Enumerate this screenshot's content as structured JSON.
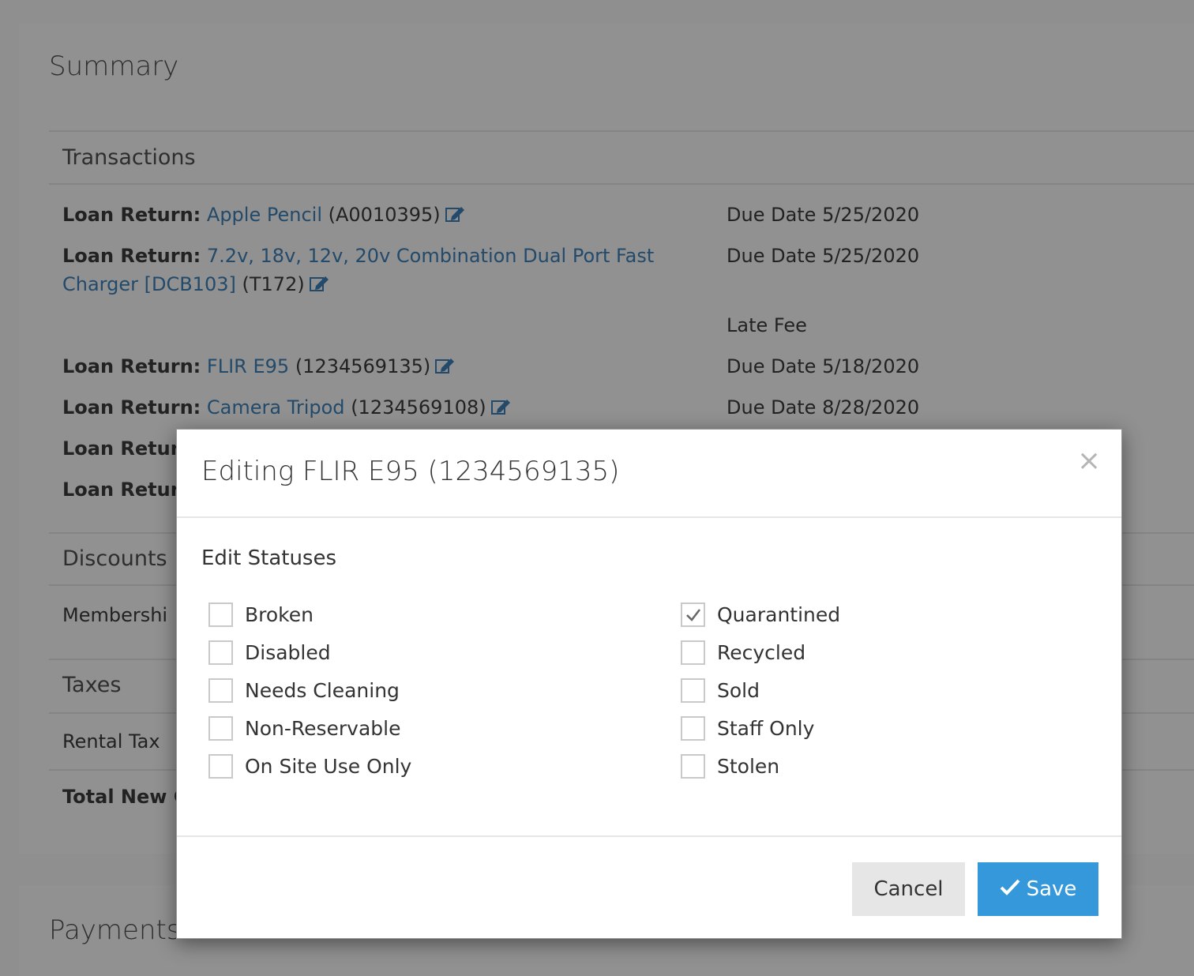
{
  "summary": {
    "title": "Summary",
    "transactions_title": "Transactions",
    "loan_label": "Loan Return:",
    "rows": [
      {
        "item": "Apple Pencil",
        "code": "(A0010395)",
        "due": "Due Date 5/25/2020"
      },
      {
        "item_line1": "7.2v, 18v, 12v, 20v Combination Dual Port Fast",
        "item_line2": "Charger [DCB103]",
        "code": "(T172)",
        "due": "Due Date 5/25/2020",
        "extra": "Late Fee"
      },
      {
        "item": "FLIR E95",
        "code": "(1234569135)",
        "due": "Due Date 5/18/2020"
      },
      {
        "item": "Camera Tripod",
        "code": "(1234569108)",
        "due": "Due Date 8/28/2020"
      },
      {
        "partial": "Loan Retur"
      },
      {
        "partial": "Loan Retur"
      }
    ],
    "discounts_title": "Discounts",
    "membership_partial": "Membershi",
    "taxes_title": "Taxes",
    "rental_tax": "Rental Tax",
    "total_partial": "Total New C"
  },
  "payments": {
    "title": "Payments"
  },
  "modal": {
    "title": "Editing FLIR E95 (1234569135)",
    "close": "×",
    "section_label": "Edit Statuses",
    "statuses_left": [
      {
        "label": "Broken",
        "checked": false
      },
      {
        "label": "Disabled",
        "checked": false
      },
      {
        "label": "Needs Cleaning",
        "checked": false
      },
      {
        "label": "Non-Reservable",
        "checked": false
      },
      {
        "label": "On Site Use Only",
        "checked": false
      }
    ],
    "statuses_right": [
      {
        "label": "Quarantined",
        "checked": true
      },
      {
        "label": "Recycled",
        "checked": false
      },
      {
        "label": "Sold",
        "checked": false
      },
      {
        "label": "Staff Only",
        "checked": false
      },
      {
        "label": "Stolen",
        "checked": false
      }
    ],
    "cancel_label": "Cancel",
    "save_label": "Save"
  },
  "colors": {
    "link": "#234a6a",
    "primary": "#3498db",
    "overlay": "#8f8f8f"
  }
}
